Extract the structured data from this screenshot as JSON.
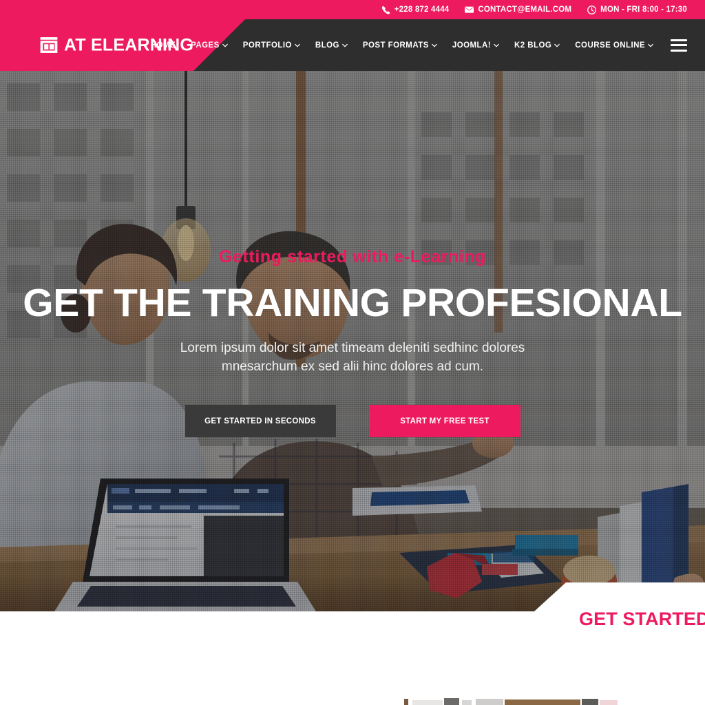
{
  "topbar": {
    "items": [
      {
        "icon": "phone-icon",
        "text": "+228 872 4444"
      },
      {
        "icon": "envelope-icon",
        "text": "CONTACT@EMAIL.COM"
      },
      {
        "icon": "clock-icon",
        "text": "MON - FRI 8:00 - 17:30"
      }
    ]
  },
  "brand": {
    "name": "AT ELEARNING",
    "icon": "projector-screen-icon"
  },
  "nav": {
    "items": [
      {
        "label": "HOME",
        "has_dropdown": false
      },
      {
        "label": "PAGES",
        "has_dropdown": true
      },
      {
        "label": "PORTFOLIO",
        "has_dropdown": true
      },
      {
        "label": "BLOG",
        "has_dropdown": true
      },
      {
        "label": "POST FORMATS",
        "has_dropdown": true
      },
      {
        "label": "JOOMLA!",
        "has_dropdown": true
      },
      {
        "label": "K2 BLOG",
        "has_dropdown": true
      },
      {
        "label": "COURSE ONLINE",
        "has_dropdown": true
      }
    ],
    "menu_toggle_icon": "hamburger-menu-icon"
  },
  "hero": {
    "kicker": "Getting started with e-Learning",
    "title": "GET THE TRAINING PROFESIONAL",
    "subtitle": "Lorem ipsum dolor sit amet timeam deleniti sedhinc dolores mnesarchum ex sed alii hinc dolores ad cum.",
    "primary_button": "GET STARTED IN SECONDS",
    "secondary_button": "START MY FREE TEST"
  },
  "section": {
    "title": "GET STARTED IN S"
  },
  "colors": {
    "brand_pink": "#ee1a5f",
    "nav_dark": "#2e2e2e",
    "button_dark": "#3a3a3a",
    "white": "#ffffff"
  }
}
